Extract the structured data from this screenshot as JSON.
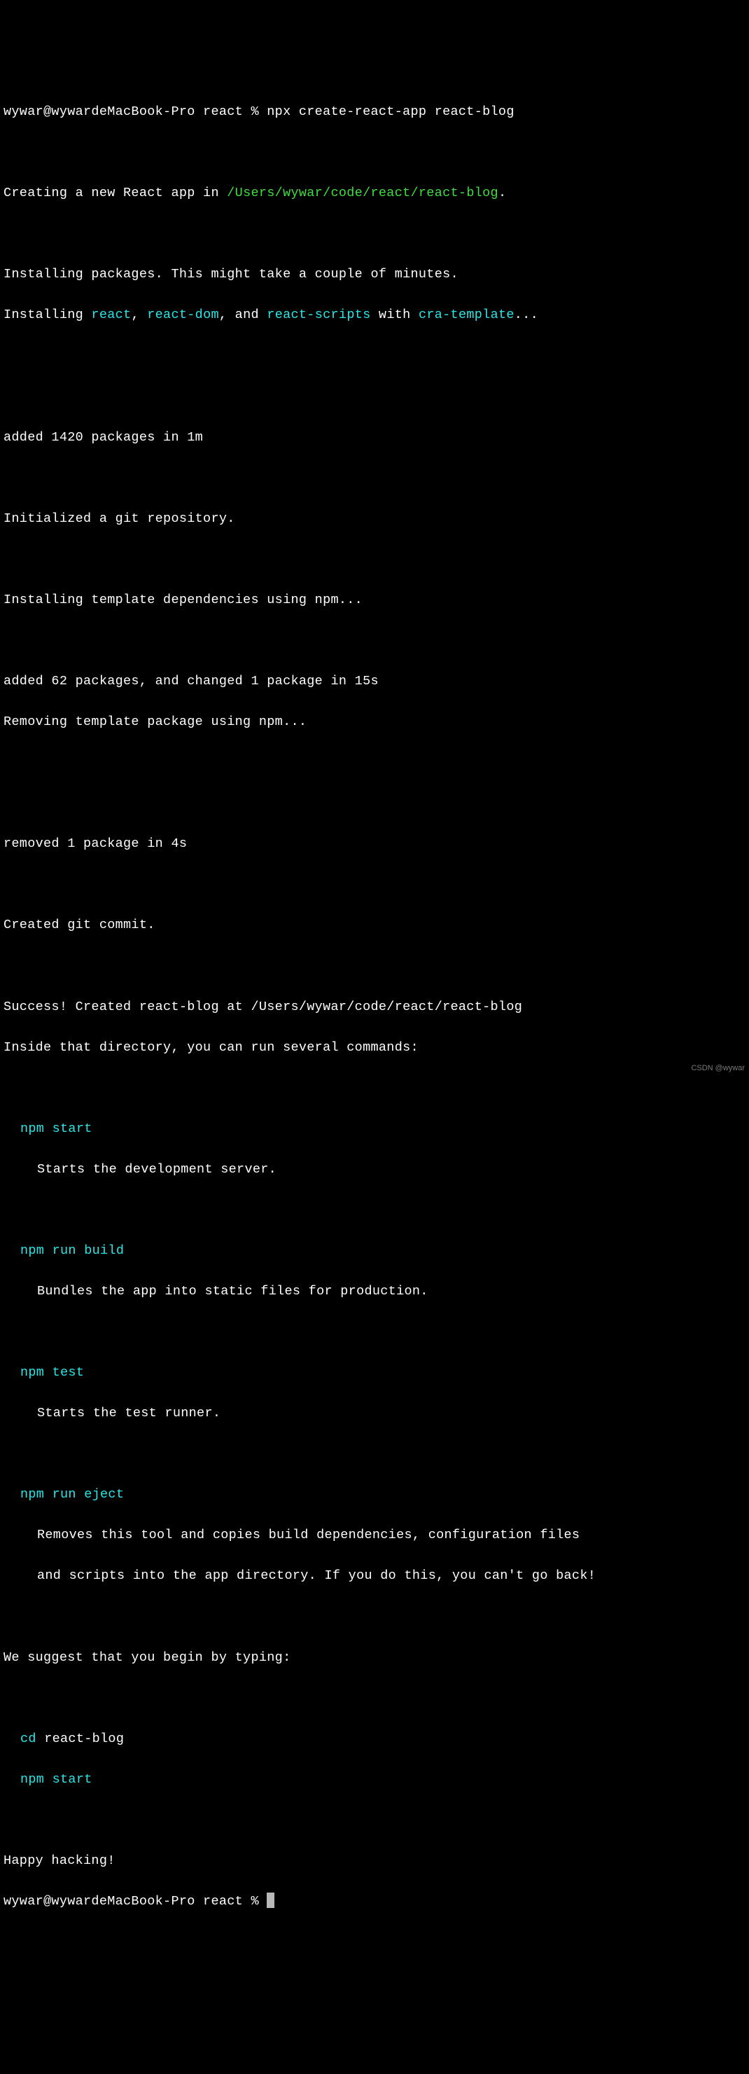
{
  "prompt1": "wywar@wywardeMacBook-Pro react % npx create-react-app react-blog",
  "creating_prefix": "Creating a new React app in ",
  "creating_path": "/Users/wywar/code/react/react-blog",
  "creating_suffix": ".",
  "install_msg1": "Installing packages. This might take a couple of minutes.",
  "install_prefix": "Installing ",
  "pkg_react": "react",
  "comma_sep": ", ",
  "pkg_reactdom": "react-dom",
  "and_sep": ", and ",
  "pkg_scripts": "react-scripts",
  "with_sep": " with ",
  "pkg_cra": "cra-template",
  "ellipsis": "...",
  "added1": "added 1420 packages in 1m",
  "git_init": "Initialized a git repository.",
  "install_tpl": "Installing template dependencies using npm...",
  "added2": "added 62 packages, and changed 1 package in 15s",
  "remove_tpl": "Removing template package using npm...",
  "removed": "removed 1 package in 4s",
  "git_commit": "Created git commit.",
  "success1": "Success! Created react-blog at /Users/wywar/code/react/react-blog",
  "success2": "Inside that directory, you can run several commands:",
  "cmd_start": "npm start",
  "desc_start": "Starts the development server.",
  "cmd_build": "npm run build",
  "desc_build": "Bundles the app into static files for production.",
  "cmd_test": "npm test",
  "desc_test": "Starts the test runner.",
  "cmd_eject": "npm run eject",
  "desc_eject1": "Removes this tool and copies build dependencies, configuration files",
  "desc_eject2": "and scripts into the app directory. If you do this, you can't go back!",
  "suggest": "We suggest that you begin by typing:",
  "cd_cmd": "cd",
  "cd_arg": " react-blog",
  "npm_start2": "npm start",
  "happy": "Happy hacking!",
  "prompt2": "wywar@wywardeMacBook-Pro react % ",
  "watermark": "CSDN @wywar"
}
